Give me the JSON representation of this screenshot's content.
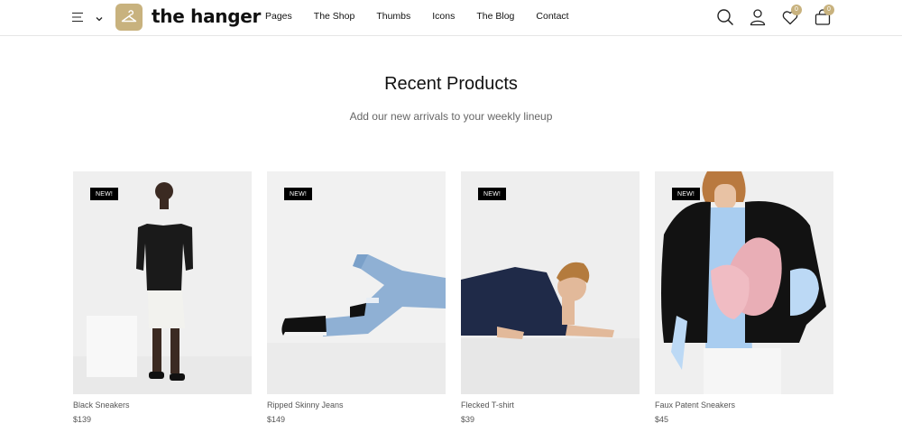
{
  "header": {
    "logo_text": "the hanger",
    "nav": [
      "Pages",
      "The Shop",
      "Thumbs",
      "Icons",
      "The Blog",
      "Contact"
    ],
    "wishlist_count": "0",
    "cart_count": "0"
  },
  "section": {
    "title": "Recent Products",
    "subtitle": "Add our new arrivals to your weekly lineup"
  },
  "products": [
    {
      "badge": "NEW!",
      "name": "Black Sneakers",
      "price": "$139"
    },
    {
      "badge": "NEW!",
      "name": "Ripped Skinny Jeans",
      "price": "$149"
    },
    {
      "badge": "NEW!",
      "name": "Flecked T-shirt",
      "price": "$39"
    },
    {
      "badge": "NEW!",
      "name": "Faux Patent Sneakers",
      "price": "$45"
    }
  ],
  "colors": {
    "accent": "#c8b27e",
    "badge_bg": "#000000",
    "image_bg": "#eeeeee"
  }
}
